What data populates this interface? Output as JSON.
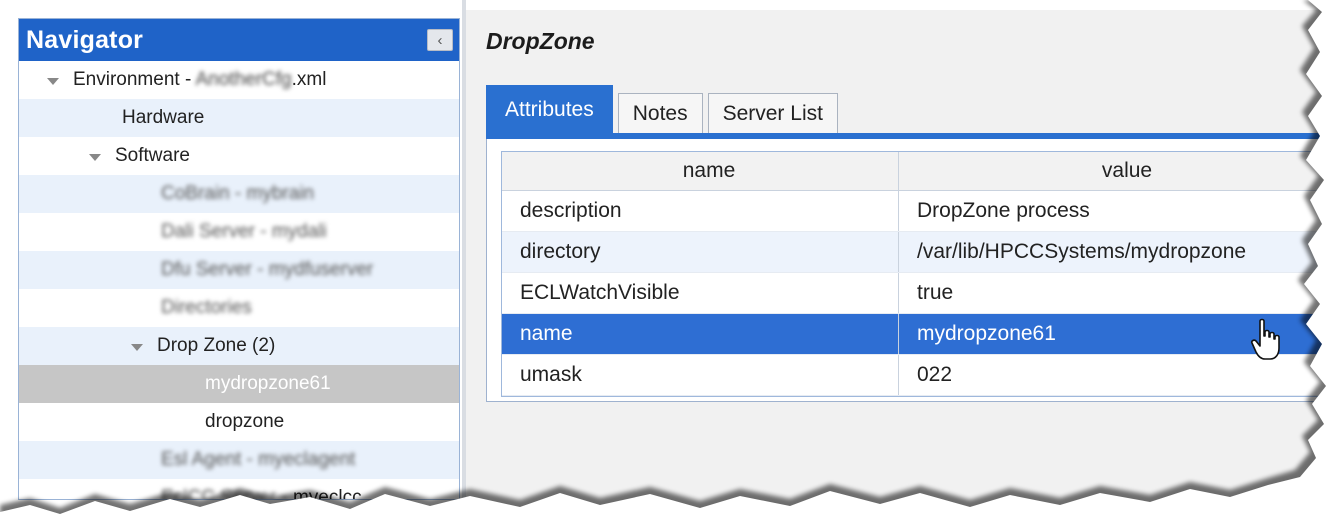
{
  "navigator": {
    "title": "Navigator",
    "collapse_glyph": "‹",
    "tree": [
      {
        "label_prefix": "Environment - ",
        "label_blurred": "AnotherCfg",
        "label_suffix": ".xml",
        "depth": 0,
        "expandable": true
      },
      {
        "label": "Hardware",
        "depth": 1
      },
      {
        "label": "Software",
        "depth": 0.9,
        "expandable": true
      },
      {
        "label": "CoBrain - mybrain",
        "depth": 2,
        "blurred": true
      },
      {
        "label": "Dali Server - mydali",
        "depth": 2,
        "blurred": true
      },
      {
        "label": "Dfu Server - mydfuserver",
        "depth": 2,
        "blurred": true
      },
      {
        "label": "Directories",
        "depth": 2,
        "blurred": true
      },
      {
        "label": "Drop Zone (2)",
        "depth": 1.8,
        "expandable": true
      },
      {
        "label": "mydropzone61",
        "depth": 3,
        "selected": true
      },
      {
        "label": "dropzone",
        "depth": 3
      },
      {
        "label": "Esl Agent - myeclagent",
        "depth": 2,
        "blurred": true
      },
      {
        "label_blurred": "EclCC Server - ",
        "label_suffix": "myeclcc",
        "depth": 2,
        "partial": true
      }
    ]
  },
  "main": {
    "title": "DropZone",
    "tabs": [
      {
        "label": "Attributes",
        "active": true
      },
      {
        "label": "Notes",
        "active": false
      },
      {
        "label": "Server List",
        "active": false
      }
    ],
    "grid": {
      "columns": [
        "name",
        "value"
      ],
      "rows": [
        {
          "name": "description",
          "value": "DropZone process"
        },
        {
          "name": "directory",
          "value": "/var/lib/HPCCSystems/mydropzone"
        },
        {
          "name": "ECLWatchVisible",
          "value": "true"
        },
        {
          "name": "name",
          "value": "mydropzone61",
          "selected": true
        },
        {
          "name": "umask",
          "value": "022"
        }
      ]
    }
  },
  "icons": {
    "cursor": "hand-pointer-icon",
    "expander": "triangle-down-icon"
  },
  "colors": {
    "accent": "#2a70d0",
    "nav_header": "#1f63c8",
    "row_alt": "#e9f1fb",
    "selected_tree": "#c6c6c6"
  }
}
